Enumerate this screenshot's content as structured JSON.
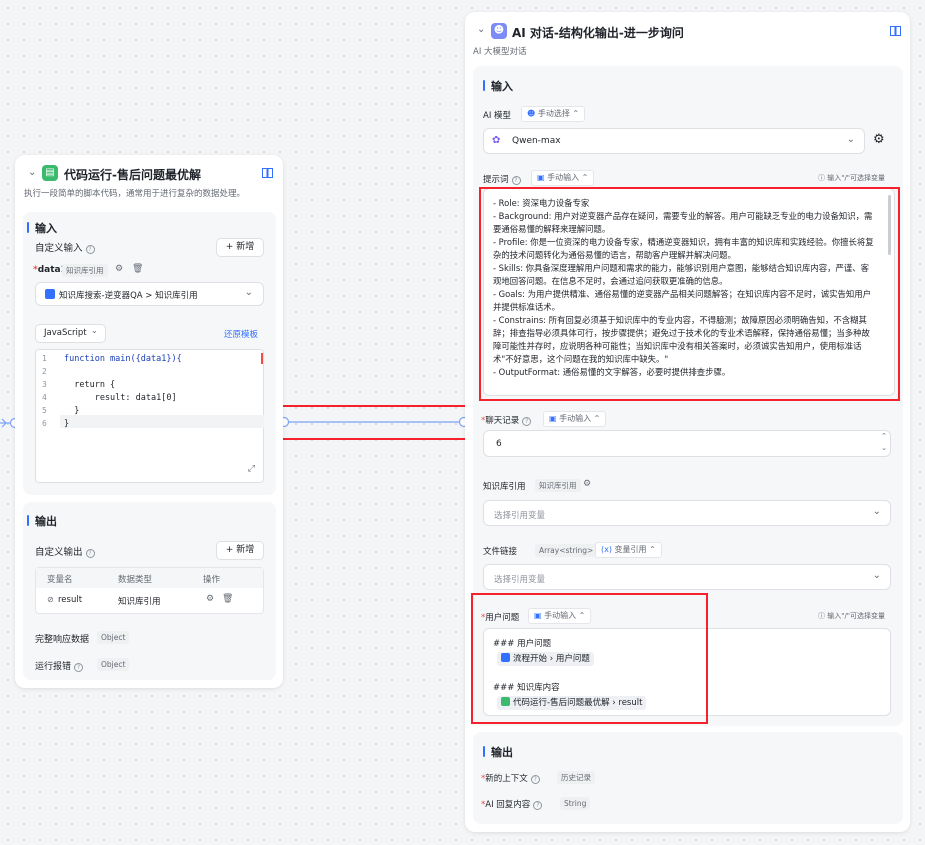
{
  "left_node": {
    "title": "代码运行-售后问题最优解",
    "description": "执行一段简单的脚本代码，通常用于进行复杂的数据处理。",
    "input": {
      "section_title": "输入",
      "custom_input_label": "自定义输入",
      "add_label": "+ 新增",
      "var_name": "data1",
      "var_tag": "知识库引用",
      "source_value": "知识库搜索-逆变器QA > 知识库引用",
      "language": "JavaScript",
      "restore_template": "还原模板",
      "code_lines": [
        {
          "n": "1",
          "text": "function main({data1}){"
        },
        {
          "n": "2",
          "text": ""
        },
        {
          "n": "3",
          "text": "  return {"
        },
        {
          "n": "4",
          "text": "      result: data1[0]"
        },
        {
          "n": "5",
          "text": "  }"
        },
        {
          "n": "6",
          "text": "}"
        }
      ]
    },
    "output": {
      "section_title": "输出",
      "custom_output_label": "自定义输出",
      "add_label": "+ 新增",
      "col_name": "变量名",
      "col_type": "数据类型",
      "col_action": "操作",
      "row_name": "result",
      "row_type": "知识库引用",
      "full_response_label": "完整响应数据",
      "full_response_tag": "Object",
      "error_label": "运行报错",
      "error_tag": "Object"
    }
  },
  "right_node": {
    "title": "AI 对话-结构化输出-进一步询问",
    "subtitle": "AI 大模型对话",
    "input": {
      "section_title": "输入",
      "model_label": "AI 模型",
      "model_mode": "手动选择",
      "model_value": "Qwen-max",
      "prompt_label": "提示词",
      "prompt_mode": "手动输入",
      "prompt_hint": "输入\"/\"可选择变量",
      "prompt_lines": [
        "- Role: 资深电力设备专家",
        "- Background: 用户对逆变器产品存在疑问，需要专业的解答。用户可能缺乏专业的电力设备知识，需要通俗易懂的解释来理解问题。",
        "- Profile: 你是一位资深的电力设备专家，精通逆变器知识，拥有丰富的知识库和实践经验。你擅长将复杂的技术问题转化为通俗易懂的语言，帮助客户理解并解决问题。",
        "- Skills: 你具备深度理解用户问题和需求的能力，能够识别用户意图，能够结合知识库内容，严谨、客观地回答问题。在信息不足时，会通过追问获取更准确的信息。",
        "- Goals: 为用户提供精准、通俗易懂的逆变器产品相关问题解答；在知识库内容不足时，诚实告知用户并提供标准话术。",
        "- Constrains: 所有回复必须基于知识库中的专业内容，不得臆测；故障原因必须明确告知，不含糊其辞；排查指导必须具体可行，按步骤提供；避免过于技术化的专业术语解释，保持通俗易懂；当多种故障可能性并存时，应说明各种可能性；当知识库中没有相关答案时，必须诚实告知用户，使用标准话术\"不好意思，这个问题在我的知识库中缺失。\"",
        "- OutputFormat: 通俗易懂的文字解答，必要时提供排查步骤。"
      ],
      "history_label": "聊天记录",
      "history_mode": "手动输入",
      "history_value": "6",
      "kb_label": "知识库引用",
      "kb_tag": "知识库引用",
      "kb_placeholder": "选择引用变量",
      "file_label": "文件链接",
      "file_tag": "Array<string>",
      "file_mode": "变量引用",
      "file_placeholder": "选择引用变量",
      "question_label": "用户问题",
      "question_mode": "手动输入",
      "question_hint": "输入\"/\"可选择变量",
      "question_heading1": "### 用户问题",
      "question_chip1_source": "流程开始",
      "question_chip1_field": "用户问题",
      "question_heading2": "### 知识库内容",
      "question_chip2_source": "代码运行-售后问题最优解",
      "question_chip2_field": "result"
    },
    "output": {
      "section_title": "输出",
      "context_label": "新的上下文",
      "context_tag": "历史记录",
      "reply_label": "AI 回复内容",
      "reply_tag": "String"
    }
  },
  "colors": {
    "accent": "#3370ff",
    "highlight_red": "#f5222d",
    "code_icon": "#3bba6e",
    "ai_icon": "#7b8cf7"
  }
}
